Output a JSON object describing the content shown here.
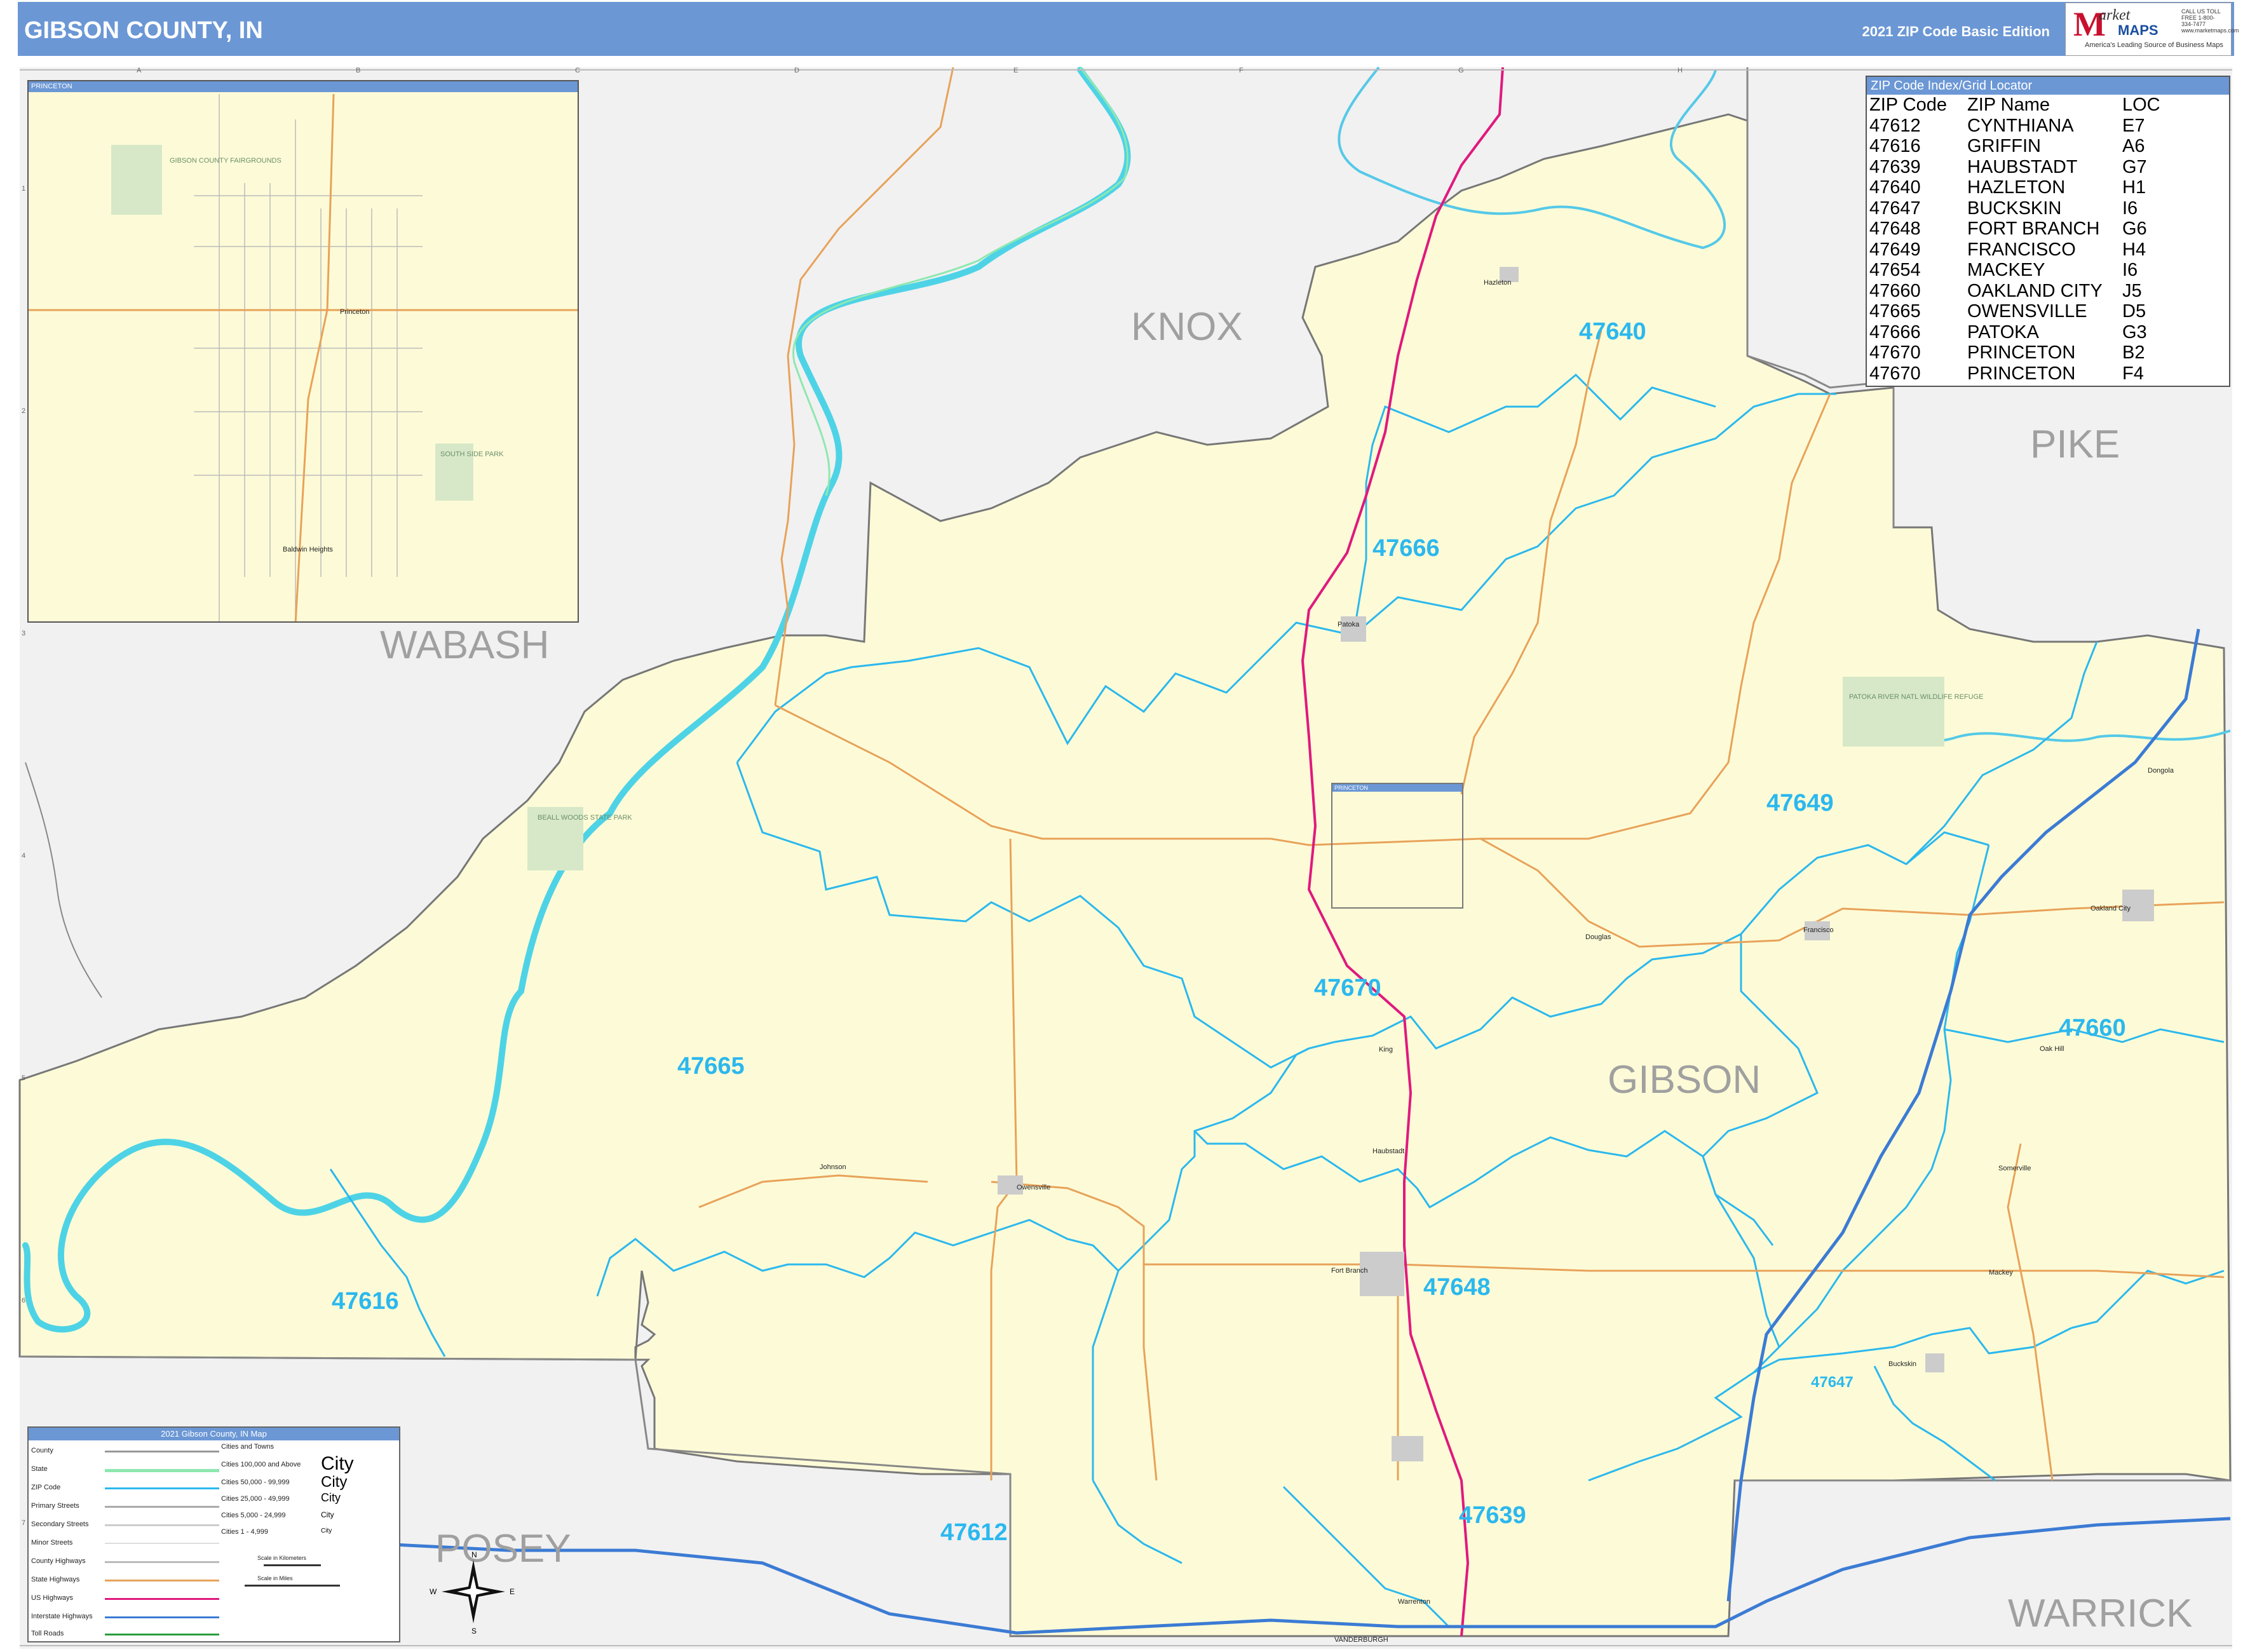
{
  "header": {
    "title": "GIBSON COUNTY, IN",
    "edition": "2021 ZIP Code Basic Edition",
    "logo": {
      "m": "M",
      "market": "arket",
      "maps": "MAPS",
      "tagline": "America's Leading Source of Business Maps",
      "contact": "CALL US TOLL FREE 1-800-334-7477 www.marketmaps.com"
    }
  },
  "grid": {
    "columns": [
      "A",
      "B",
      "C",
      "D",
      "E",
      "F",
      "G",
      "H"
    ],
    "rows": [
      "1",
      "2",
      "3",
      "4",
      "5",
      "6",
      "7"
    ]
  },
  "counties": {
    "knox": "KNOX",
    "pike": "PIKE",
    "wabash": "WABASH",
    "gibson": "GIBSON",
    "posey": "POSEY",
    "warrick": "WARRICK",
    "vanderburgh": "VANDERBURGH"
  },
  "zip_labels": {
    "z47640": "47640",
    "z47666": "47666",
    "z47649": "47649",
    "z47670": "47670",
    "z47665": "47665",
    "z47660": "47660",
    "z47616": "47616",
    "z47648": "47648",
    "z47647": "47647",
    "z47612": "47612",
    "z47639": "47639"
  },
  "towns": {
    "hazleton": "Hazleton",
    "patoka": "Patoka",
    "princeton": "Princeton",
    "owensville": "Owensville",
    "johnson": "Johnson",
    "fort_branch": "Fort Branch",
    "king": "King",
    "haubstadt": "Haubstadt",
    "douglas": "Douglas",
    "francisco": "Francisco",
    "oakland_city": "Oakland City",
    "dongola": "Dongola",
    "oak_hill": "Oak Hill",
    "somerville": "Somerville",
    "mackey": "Mackey",
    "buckskin": "Buckskin",
    "warrenton": "Warrenton",
    "baldwin_heights": "Baldwin Heights"
  },
  "parks": {
    "beall_woods": "BEALL WOODS STATE PARK",
    "patoka_refuge": "PATOKA RIVER NATL WILDLIFE REFUGE",
    "fairgrounds": "GIBSON COUNTY FAIRGROUNDS",
    "south_side_park": "SOUTH SIDE PARK"
  },
  "zip_index": {
    "title": "ZIP Code Index/Grid Locator",
    "headers": [
      "ZIP Code",
      "ZIP Name",
      "LOC"
    ],
    "rows": [
      [
        "47612",
        "CYNTHIANA",
        "E7"
      ],
      [
        "47616",
        "GRIFFIN",
        "A6"
      ],
      [
        "47639",
        "HAUBSTADT",
        "G7"
      ],
      [
        "47640",
        "HAZLETON",
        "H1"
      ],
      [
        "47647",
        "BUCKSKIN",
        "I6"
      ],
      [
        "47648",
        "FORT BRANCH",
        "G6"
      ],
      [
        "47649",
        "FRANCISCO",
        "H4"
      ],
      [
        "47654",
        "MACKEY",
        "I6"
      ],
      [
        "47660",
        "OAKLAND CITY",
        "J5"
      ],
      [
        "47665",
        "OWENSVILLE",
        "D5"
      ],
      [
        "47666",
        "PATOKA",
        "G3"
      ],
      [
        "47670",
        "PRINCETON",
        "B2"
      ],
      [
        "47670",
        "PRINCETON",
        "F4"
      ]
    ]
  },
  "inset": {
    "title": "PRINCETON",
    "town": "Princeton"
  },
  "mini_inset": {
    "title": "PRINCETON"
  },
  "legend": {
    "title": "2021 Gibson County, IN Map",
    "items": [
      "County",
      "State",
      "ZIP Code",
      "Primary Streets",
      "Secondary Streets",
      "Minor Streets",
      "County Highways",
      "State Highways",
      "US Highways",
      "Interstate Highways",
      "Toll Roads"
    ],
    "cities_header": "Cities and Towns",
    "cities": [
      {
        "range": "Cities 100,000 and Above",
        "sample": "City"
      },
      {
        "range": "Cities 50,000 - 99,999",
        "sample": "City"
      },
      {
        "range": "Cities 25,000 - 49,999",
        "sample": "City"
      },
      {
        "range": "Cities 5,000 - 24,999",
        "sample": "City"
      },
      {
        "range": "Cities 1 - 4,999",
        "sample": "City"
      }
    ],
    "scale_km": "Scale in Kilometers",
    "scale_mi": "Scale in Miles",
    "compass": {
      "n": "N",
      "s": "S",
      "e": "E",
      "w": "W"
    }
  }
}
